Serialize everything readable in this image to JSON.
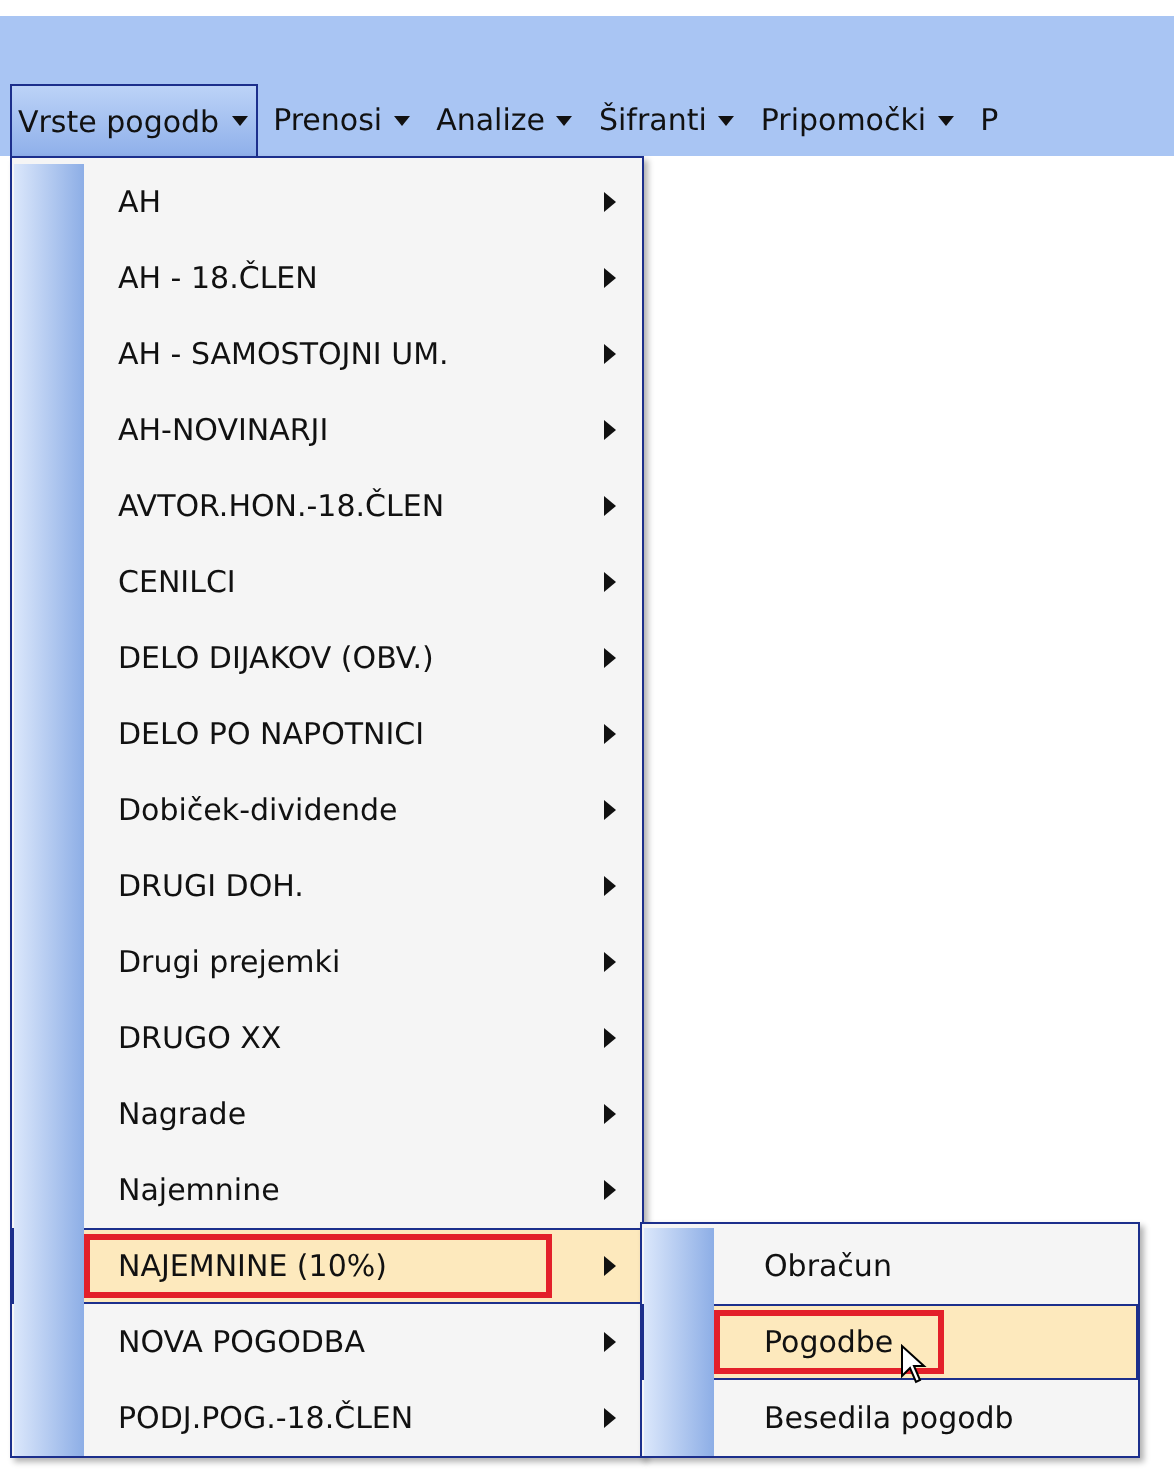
{
  "menu_bar": [
    {
      "label": "Vrste pogodb",
      "selected": true
    },
    {
      "label": "Prenosi",
      "selected": false
    },
    {
      "label": "Analize",
      "selected": false
    },
    {
      "label": "Šifranti",
      "selected": false
    },
    {
      "label": "Pripomočki",
      "selected": false
    },
    {
      "label": "P",
      "selected": false
    }
  ],
  "dropdown": {
    "items": [
      {
        "label": "AH",
        "selected": false,
        "marked": false
      },
      {
        "label": "AH - 18.ČLEN",
        "selected": false,
        "marked": false
      },
      {
        "label": "AH - SAMOSTOJNI UM.",
        "selected": false,
        "marked": false
      },
      {
        "label": "AH-NOVINARJI",
        "selected": false,
        "marked": false
      },
      {
        "label": "AVTOR.HON.-18.ČLEN",
        "selected": false,
        "marked": false
      },
      {
        "label": "CENILCI",
        "selected": false,
        "marked": false
      },
      {
        "label": "DELO DIJAKOV (OBV.)",
        "selected": false,
        "marked": false
      },
      {
        "label": "DELO PO NAPOTNICI",
        "selected": false,
        "marked": false
      },
      {
        "label": "Dobiček-dividende",
        "selected": false,
        "marked": false
      },
      {
        "label": "DRUGI DOH.",
        "selected": false,
        "marked": false
      },
      {
        "label": "Drugi prejemki",
        "selected": false,
        "marked": false
      },
      {
        "label": "DRUGO XX",
        "selected": false,
        "marked": false
      },
      {
        "label": "Nagrade",
        "selected": false,
        "marked": false
      },
      {
        "label": "Najemnine",
        "selected": false,
        "marked": false
      },
      {
        "label": "NAJEMNINE (10%)",
        "selected": true,
        "marked": true
      },
      {
        "label": "NOVA POGODBA",
        "selected": false,
        "marked": false
      },
      {
        "label": "PODJ.POG.-18.ČLEN",
        "selected": false,
        "marked": false
      }
    ]
  },
  "submenu": {
    "items": [
      {
        "label": "Obračun",
        "selected": false,
        "marked": false
      },
      {
        "label": "Pogodbe",
        "selected": true,
        "marked": true
      },
      {
        "label": "Besedila pogodb",
        "selected": false,
        "marked": false
      }
    ]
  }
}
